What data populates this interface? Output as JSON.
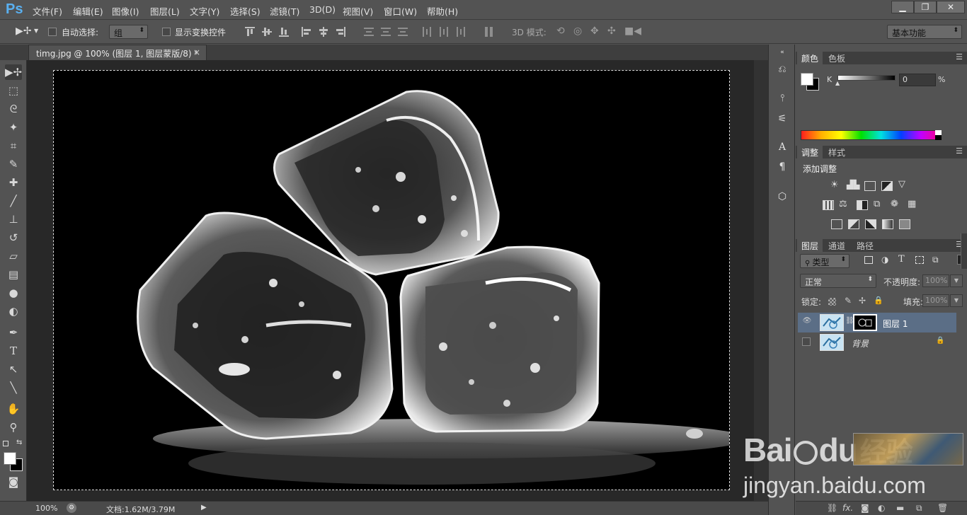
{
  "app": {
    "logo": "Ps"
  },
  "menu": [
    "文件(F)",
    "编辑(E)",
    "图像(I)",
    "图层(L)",
    "文字(Y)",
    "选择(S)",
    "滤镜(T)",
    "3D(D)",
    "视图(V)",
    "窗口(W)",
    "帮助(H)"
  ],
  "window_controls": {
    "minimize": "▁",
    "restore": "❐",
    "close": "✕"
  },
  "options": {
    "auto_select_label": "自动选择:",
    "auto_select_value": "组",
    "show_transform_label": "显示变换控件",
    "mode_3d_label": "3D 模式:",
    "workspace": "基本功能"
  },
  "document_tab": {
    "title": "timg.jpg @ 100% (图层 1, 图层蒙版/8) *",
    "close": "×"
  },
  "status": {
    "zoom": "100%",
    "doc_info": "文档:1.62M/3.79M"
  },
  "color_panel": {
    "tabs": [
      "颜色",
      "色板"
    ],
    "channel": "K",
    "value": "0",
    "unit": "%"
  },
  "adjust_panel": {
    "tabs": [
      "调整",
      "样式"
    ],
    "heading": "添加调整"
  },
  "layers_panel": {
    "tabs": [
      "图层",
      "通道",
      "路径"
    ],
    "filter_kind": "类型",
    "blend_mode": "正常",
    "opacity_label": "不透明度:",
    "opacity_value": "100%",
    "lock_label": "锁定:",
    "fill_label": "填充:",
    "fill_value": "100%",
    "layers": [
      {
        "name": "图层 1",
        "selected": true
      },
      {
        "name": "背景",
        "selected": false
      }
    ]
  },
  "watermark": {
    "brand_a": "Bai",
    "brand_b": "du",
    "brand_cn": "经验",
    "url": "jingyan.baidu.com"
  },
  "colors": {
    "app_bg": "#535353",
    "canvas_bg": "#282828",
    "selected_layer": "#5b6e86",
    "ps_blue": "#5ab0f0"
  }
}
